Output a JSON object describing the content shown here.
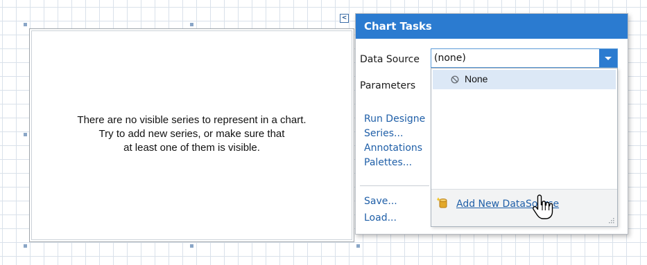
{
  "chart": {
    "empty_message_line1": "There are no visible series to represent in a chart.",
    "empty_message_line2": "Try to add new series, or make sure that",
    "empty_message_line3": "at least one of them is visible."
  },
  "smart_tag": {
    "glyph": "<"
  },
  "tasks_panel": {
    "title": "Chart Tasks",
    "data_source_label": "Data Source",
    "data_source_value": "(none)",
    "parameters_label": "Parameters",
    "links": [
      "Run Designe",
      "Series...",
      "Annotations",
      "Palettes..."
    ],
    "links2": [
      "Save...",
      "Load..."
    ]
  },
  "dropdown": {
    "options": [
      {
        "label": "None",
        "icon": "ban-icon",
        "selected": true
      }
    ],
    "add_new_label": "Add New DataSource",
    "add_new_icon": "database-add-icon"
  },
  "colors": {
    "header_blue": "#2b7bd0",
    "link_blue": "#1f5fa8",
    "selected_row": "#dce8f6"
  }
}
